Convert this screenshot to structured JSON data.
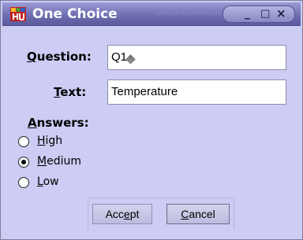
{
  "window": {
    "title": "One Choice",
    "icon": "app-icon",
    "controls": {
      "minimize": "_",
      "maximize": "□",
      "close": "×"
    }
  },
  "form": {
    "question_label": "Question:",
    "question_value": "Q1",
    "text_label": "Text:",
    "text_value": "Temperature"
  },
  "answers": {
    "label": "Answers:",
    "options": [
      {
        "label": "High",
        "selected": false
      },
      {
        "label": "Medium",
        "selected": true
      },
      {
        "label": "Low",
        "selected": false
      }
    ]
  },
  "buttons": {
    "accept": "Accept",
    "cancel": "Cancel"
  },
  "colors": {
    "dialog_background": "#ccccf4",
    "titlebar": "#6f6fb2",
    "field_background": "#ffffff"
  }
}
